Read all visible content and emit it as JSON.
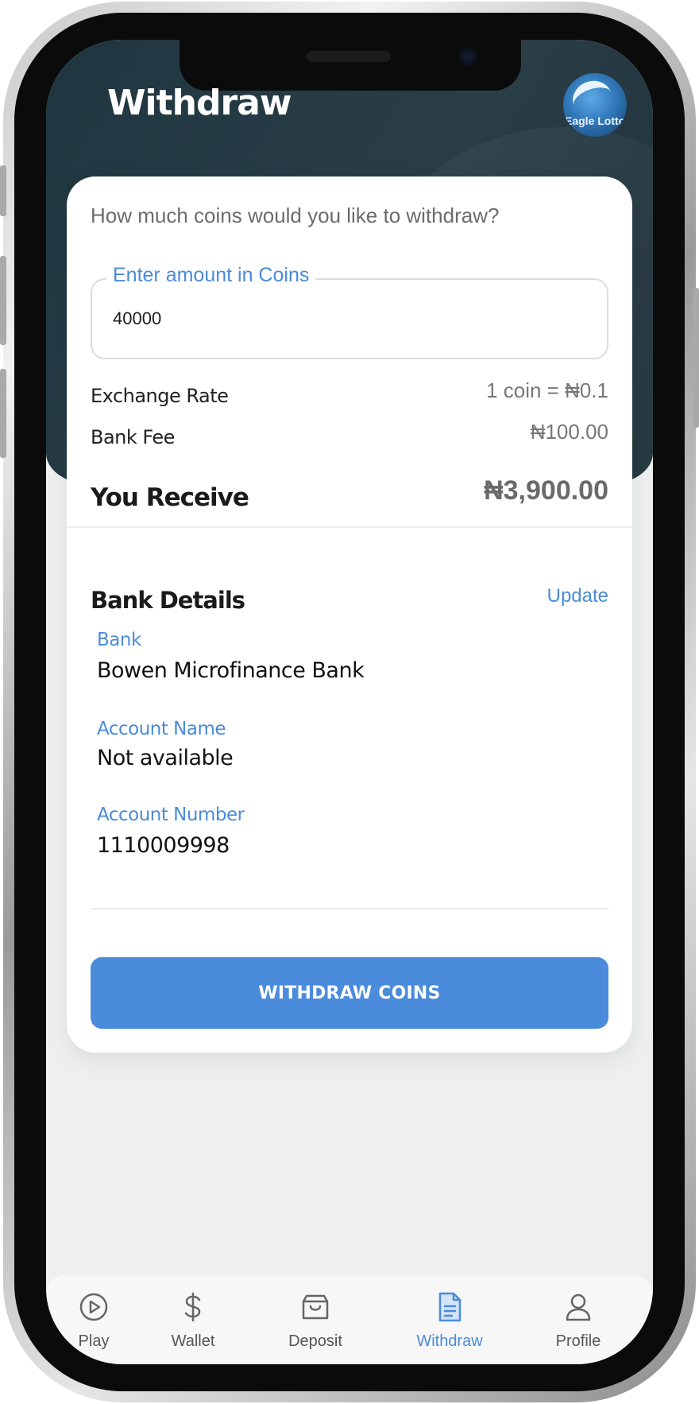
{
  "header": {
    "title": "Withdraw",
    "logo_text": "Eagle Lotto"
  },
  "withdraw_form": {
    "question": "How much coins would you like to withdraw?",
    "amount_label": "Enter amount in Coins",
    "amount_value": "40000",
    "exchange_rate_label": "Exchange Rate",
    "exchange_rate_value": "1 coin = ₦0.1",
    "bank_fee_label": "Bank Fee",
    "bank_fee_value": "₦100.00",
    "receive_label": "You Receive",
    "receive_value": "₦3,900.00"
  },
  "bank_details": {
    "title": "Bank Details",
    "update_label": "Update",
    "bank_label": "Bank",
    "bank_value": "Bowen Microfinance Bank",
    "account_name_label": "Account Name",
    "account_name_value": "Not available",
    "account_number_label": "Account Number",
    "account_number_value": "1110009998"
  },
  "actions": {
    "withdraw_button": "WITHDRAW COINS"
  },
  "nav": {
    "items": [
      {
        "label": "Play",
        "icon": "play-icon"
      },
      {
        "label": "Wallet",
        "icon": "dollar-icon"
      },
      {
        "label": "Deposit",
        "icon": "shopping-bag-icon"
      },
      {
        "label": "Withdraw",
        "icon": "document-icon",
        "active": true
      },
      {
        "label": "Profile",
        "icon": "user-icon"
      }
    ]
  },
  "colors": {
    "accent": "#4a8bdc",
    "header_bg": "#243a44",
    "screen_bg": "#eef0ef"
  }
}
